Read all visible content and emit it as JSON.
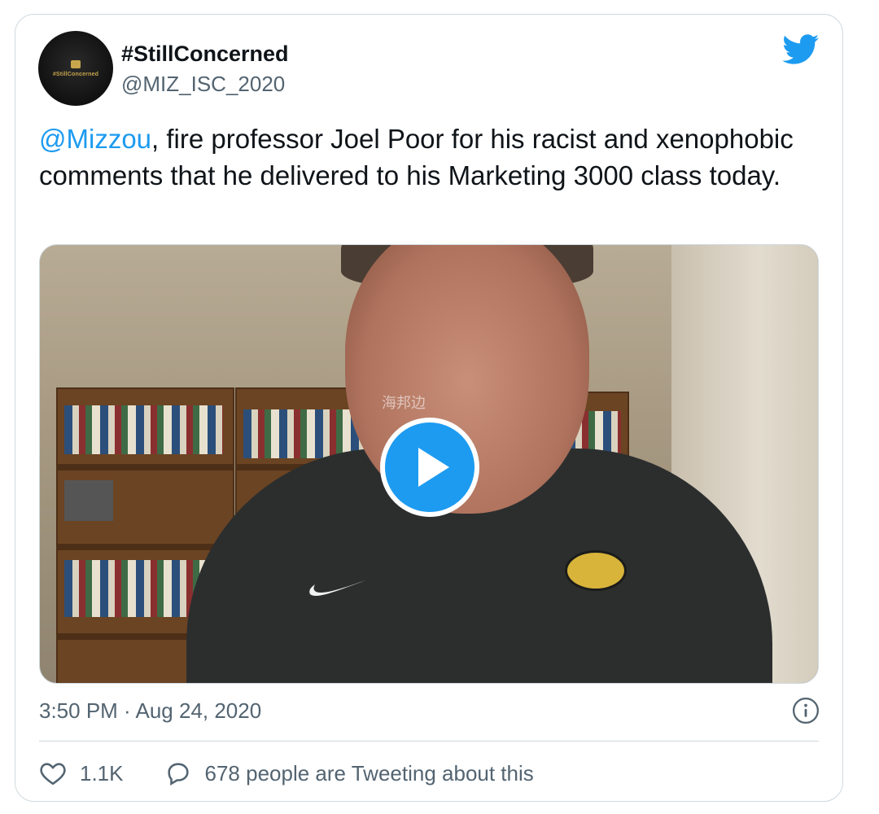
{
  "tweet": {
    "avatar_text": "#StillConcerned",
    "display_name": "#StillConcerned",
    "handle": "@MIZ_ISC_2020",
    "text_mention": "@Mizzou",
    "text_body": ", fire professor Joel Poor for his racist and xenophobic comments that he delivered to his Marketing 3000 class today.",
    "timestamp": "3:50 PM · Aug 24, 2020",
    "like_count": "1.1K",
    "reply_label": "678 people are Tweeting about this"
  },
  "media": {
    "watermark": "海邦边"
  },
  "colors": {
    "accent": "#1d9bf0",
    "secondary_text": "#536471",
    "border": "#cfd9de"
  },
  "icons": {
    "brand": "twitter-bird-icon",
    "play": "play-icon",
    "info": "info-icon",
    "like": "heart-icon",
    "reply": "speech-bubble-icon"
  }
}
